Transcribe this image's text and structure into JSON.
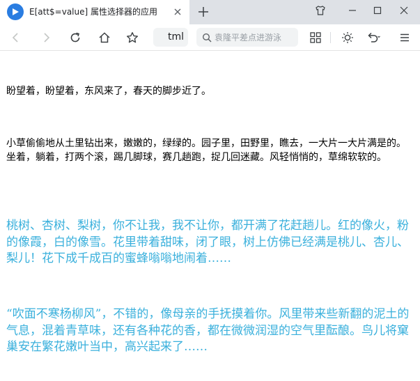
{
  "browser": {
    "tab": {
      "title": "E[att$=value] 属性选择器的应用"
    },
    "address_text": "tml",
    "search_placeholder": "袁隆平差点进游泳"
  },
  "colors": {
    "highlight_text": "#3ab0dc",
    "normal_text": "#000000"
  },
  "icons": {
    "logo": "browser-logo-icon",
    "tab_close": "close-icon",
    "new_tab": "plus-icon",
    "skin": "shirt-icon",
    "minimize": "minimize-icon",
    "maximize": "maximize-icon",
    "close": "close-icon",
    "back": "back-arrow-icon",
    "forward": "forward-arrow-icon",
    "reload": "reload-icon",
    "home": "home-icon",
    "favorite": "star-icon",
    "search": "search-icon",
    "apps": "grid-icon",
    "brightness": "sun-icon",
    "undo": "undo-icon",
    "menu": "hamburger-menu-icon"
  },
  "content": {
    "paragraphs": [
      "盼望着，盼望着，东风来了，春天的脚步近了。",
      "小草偷偷地从土里钻出来，嫩嫩的，绿绿的。园子里，田野里，瞧去，一大片一大片满是的。坐着，躺着，打两个滚，踢几脚球，赛几趟跑，捉几回迷藏。风轻悄悄的，草绵软软的。",
      "桃树、杏树、梨树，你不让我，我不让你，都开满了花赶趟儿。红的像火，粉的像霞，白的像雪。花里带着甜味，闭了眼，树上仿佛已经满是桃儿、杏儿、梨儿！花下成千成百的蜜蜂嗡嗡地闹着……",
      "“吹面不寒杨柳风”，不错的，像母亲的手抚摸着你。风里带来些新翻的泥土的气息，混着青草味，还有各种花的香，都在微微润湿的空气里酝酿。鸟儿将窠巢安在繁花嫩叶当中，高兴起来了……"
    ]
  }
}
